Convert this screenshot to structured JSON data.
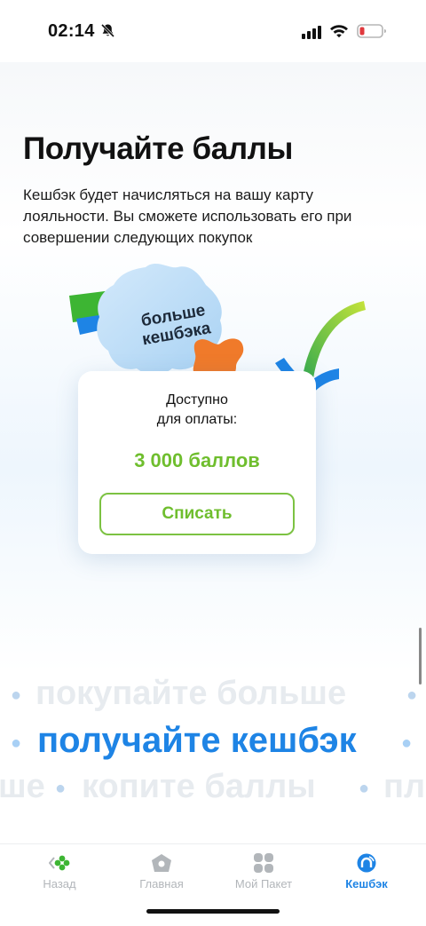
{
  "status_bar": {
    "time": "02:14"
  },
  "main": {
    "title": "Получайте баллы",
    "description": "Кешбэк будет начисляться на вашу карту лояльности. Вы сможете использовать его при совершении следующих покупок",
    "badge_text": "больше кешбэка"
  },
  "card": {
    "label_line1": "Доступно",
    "label_line2": "для оплаты:",
    "amount": "3 000 баллов",
    "button_label": "Списать",
    "accent_color": "#6fbe2e"
  },
  "marquee": {
    "line1": "покупайте больше",
    "line2": "получайте кешбэк",
    "line3_left": "ше",
    "line3_middle": "копите баллы",
    "line3_right": "пл"
  },
  "tab_bar": {
    "tabs": [
      {
        "label": "Назад",
        "icon": "back-clover-icon",
        "active": false
      },
      {
        "label": "Главная",
        "icon": "home-icon",
        "active": false
      },
      {
        "label": "Мой Пакет",
        "icon": "grid-icon",
        "active": false
      },
      {
        "label": "Кешбэк",
        "icon": "cashback-icon",
        "active": true
      }
    ],
    "active_color": "#1e84e5",
    "inactive_color": "#b2b6ba"
  }
}
